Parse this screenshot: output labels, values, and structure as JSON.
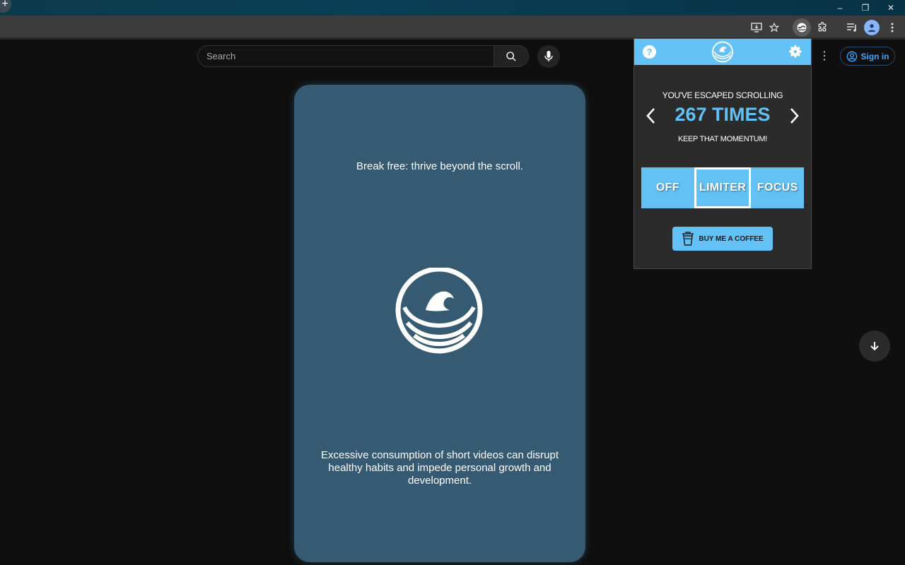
{
  "browser": {
    "newtab_label": "+",
    "window_controls": {
      "minimize": "–",
      "restore": "❐",
      "close": "✕"
    }
  },
  "youtube": {
    "search_placeholder": "Search",
    "signin_label": "Sign in"
  },
  "card": {
    "top_text": "Break free: thrive beyond the scroll.",
    "bottom_text": "Excessive consumption of short videos can disrupt healthy habits and impede personal growth and development."
  },
  "popup": {
    "help_label": "?",
    "escaped_text": "YOU'VE ESCAPED SCROLLING",
    "count_text": "267 TIMES",
    "momentum_text": "KEEP THAT MOMENTUM!",
    "modes": [
      {
        "label": "OFF",
        "active": false
      },
      {
        "label": "LIMITER",
        "active": true
      },
      {
        "label": "FOCUS",
        "active": false
      }
    ],
    "coffee_label": "BUY ME A COFFEE"
  },
  "colors": {
    "accent": "#63c1f5",
    "card_bg": "#365a72",
    "page_bg": "#0f0f0f",
    "signin_blue": "#3ea6ff"
  }
}
